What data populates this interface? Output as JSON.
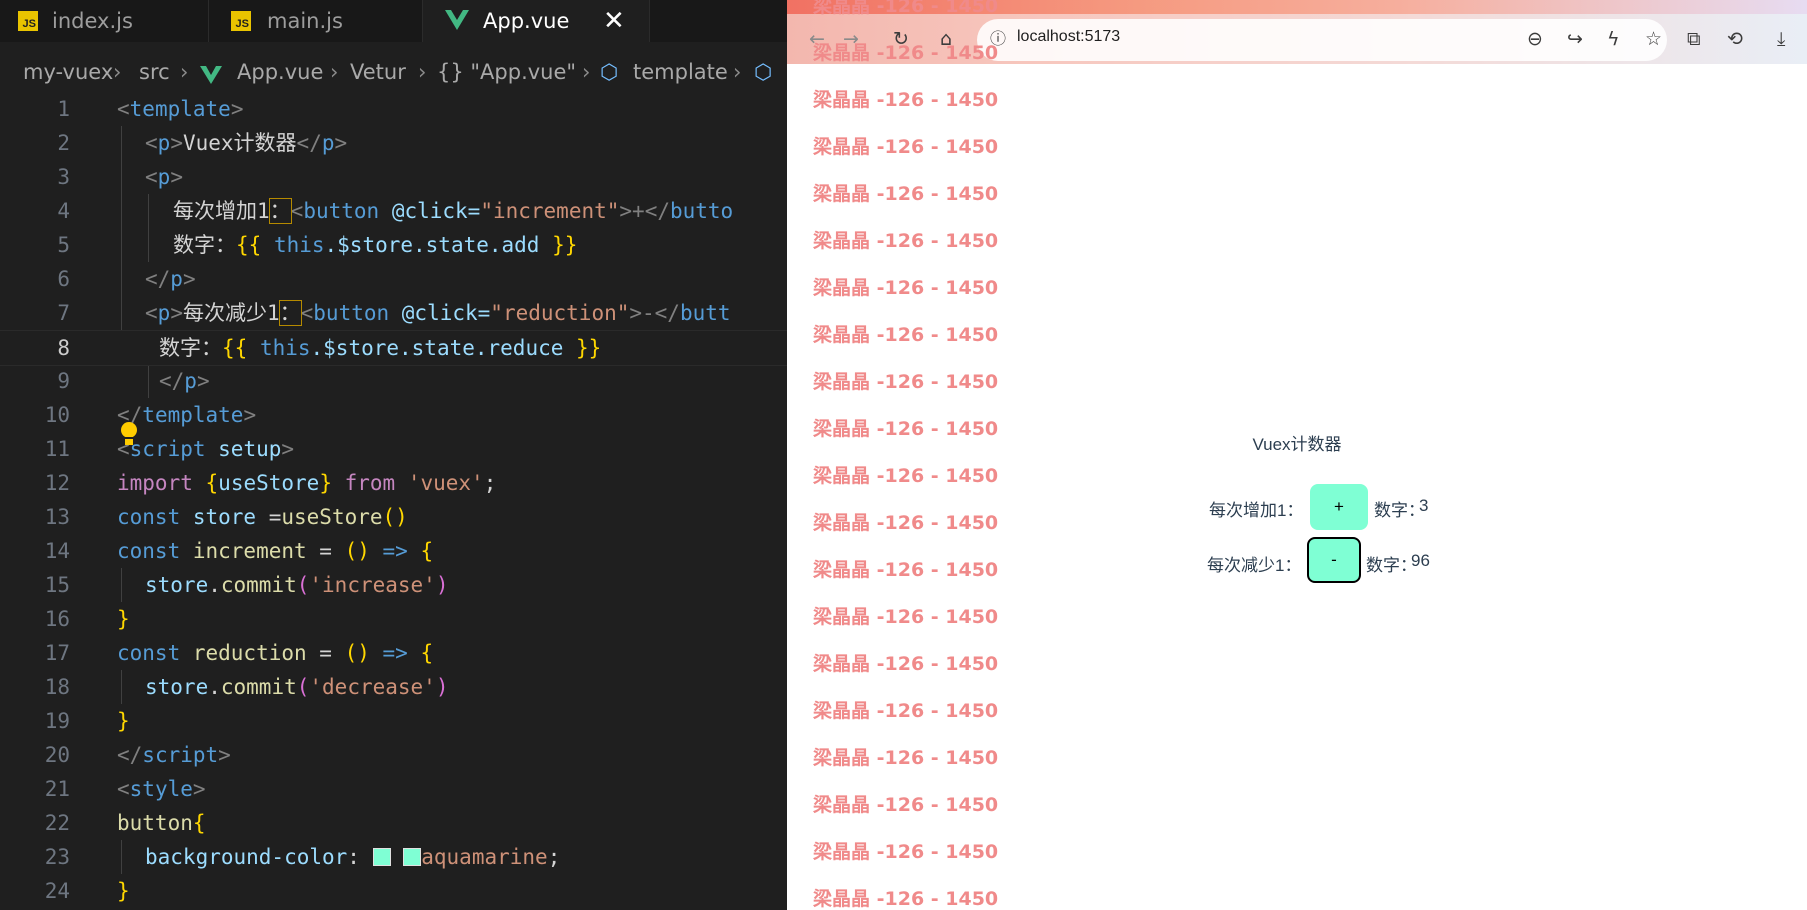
{
  "editor": {
    "tabs": [
      {
        "label": "index.js",
        "type": "js",
        "active": false
      },
      {
        "label": "main.js",
        "type": "js",
        "active": false
      },
      {
        "label": "App.vue",
        "type": "vue",
        "active": true
      }
    ],
    "breadcrumb": [
      "my-vuex",
      "src",
      "App.vue",
      "Vetur",
      "{} \"App.vue\"",
      "template"
    ],
    "current_line": 8,
    "line_numbers": [
      "1",
      "2",
      "3",
      "4",
      "5",
      "6",
      "7",
      "8",
      "9",
      "10",
      "11",
      "12",
      "13",
      "14",
      "15",
      "16",
      "17",
      "18",
      "19",
      "20",
      "21",
      "22",
      "23",
      "24"
    ],
    "code": {
      "l1": [
        "<",
        "template",
        ">"
      ],
      "l2": [
        "<",
        "p",
        ">",
        "Vuex计数器",
        "</",
        "p",
        ">"
      ],
      "l3": [
        "<",
        "p",
        ">"
      ],
      "l4": [
        "每次增加1",
        "：",
        "<",
        "button",
        " @click=",
        "\"increment\"",
        ">+</",
        "butto"
      ],
      "l5": [
        "数字：",
        "{{",
        " this",
        ".$store.state.add ",
        "}}"
      ],
      "l6": [
        "</",
        "p",
        ">"
      ],
      "l7": [
        "<",
        "p",
        ">",
        "每次减少1",
        "：",
        "<",
        "button",
        " @click=",
        "\"reduction\"",
        ">-</",
        "butt"
      ],
      "l8": [
        "数字：",
        "{{",
        " this",
        ".$store.state.reduce ",
        "}}"
      ],
      "l9": [
        "</",
        "p",
        ">"
      ],
      "l10": [
        "</",
        "template",
        ">"
      ],
      "l11": [
        "<",
        "script",
        " setup",
        ">"
      ],
      "l12": [
        "import ",
        "{",
        "useStore",
        "}",
        " from ",
        "'vuex'",
        ";"
      ],
      "l13": [
        "const ",
        "store",
        " =",
        "useStore",
        "()"
      ],
      "l14": [
        "const ",
        "increment",
        " = ",
        "()",
        " => ",
        "{"
      ],
      "l15": [
        "store",
        ".",
        "commit",
        "(",
        "'increase'",
        ")"
      ],
      "l16": [
        "}"
      ],
      "l17": [
        "const ",
        "reduction",
        " = ",
        "()",
        " => ",
        "{"
      ],
      "l18": [
        "store",
        ".",
        "commit",
        "(",
        "'decrease'",
        ")"
      ],
      "l19": [
        "}"
      ],
      "l20": [
        "</",
        "script",
        ">"
      ],
      "l21": [
        "<",
        "style",
        ">"
      ],
      "l22": [
        "button",
        "{"
      ],
      "l23": [
        "background-color",
        ": ",
        "aquamarine",
        ";"
      ],
      "l24": [
        "}"
      ]
    }
  },
  "browser": {
    "url": "localhost:5173",
    "colors": {
      "button": "#7fffd4",
      "watermark": "#f08a8a"
    },
    "watermark_text": "梁晶晶 -126 - 1450",
    "watermark_count": 20,
    "app": {
      "title": "Vuex计数器",
      "increase_label": "每次增加1：",
      "increase_button": "+",
      "increase_number_label": "数字：",
      "increase_value": "3",
      "decrease_label": "每次减少1：",
      "decrease_button": "-",
      "decrease_number_label": "数字：",
      "decrease_value": "96"
    }
  }
}
